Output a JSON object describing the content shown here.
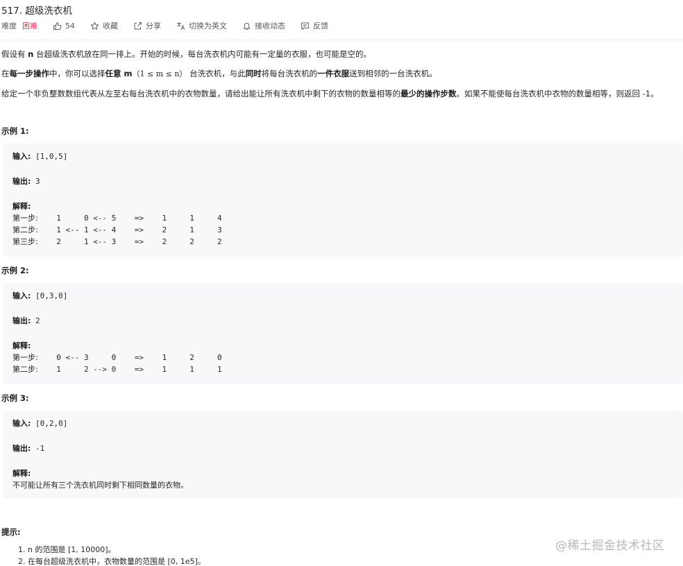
{
  "problem": {
    "title": "517. 超级洗衣机",
    "difficulty_label": "难度",
    "difficulty_value": "困难",
    "likes": "54",
    "favorite_label": "收藏",
    "share_label": "分享",
    "switch_lang_label": "切换为英文",
    "notify_label": "接收动态",
    "feedback_label": "反馈"
  },
  "colors": {
    "difficulty_hard": "#ff2d55",
    "code_bg": "#f7f8fa"
  },
  "description": {
    "p1_a": "假设有 ",
    "p1_b": "n",
    "p1_c": " 台超级洗衣机放在同一排上。开始的时候，每台洗衣机内可能有一定量的衣服，也可能是空的。",
    "p2_a": "在",
    "p2_b": "每一步操作",
    "p2_c": "中，你可以选择",
    "p2_d": "任意 m",
    "p2_e": "（1 ≤ m ≤ n）",
    "p2_f": " 台洗衣机，与此",
    "p2_g": "同时",
    "p2_h": "将每台洗衣机的",
    "p2_i": "一件衣服",
    "p2_j": "送到相邻的一台洗衣机。",
    "p3_a": "给定一个非负整数数组代表从左至右每台洗衣机中的衣物数量，请给出能让所有洗衣机中剩下的衣物的数量相等的",
    "p3_b": "最少的操作步数",
    "p3_c": "。如果不能使每台洗衣机中衣物的数量相等，则返回 -1。"
  },
  "examples": [
    {
      "title": "示例 1:",
      "input_label": "输入:",
      "input": "[1,0,5]",
      "output_label": "输出:",
      "output": "3",
      "explain_label": "解释:",
      "steps": [
        {
          "label": "第一步:",
          "text": "    1     0 <-- 5    =>    1     1     4"
        },
        {
          "label": "第二步:",
          "text": "    1 <-- 1 <-- 4    =>    2     1     3"
        },
        {
          "label": "第三步:",
          "text": "    2     1 <-- 3    =>    2     2     2"
        }
      ]
    },
    {
      "title": "示例 2:",
      "input_label": "输入:",
      "input": "[0,3,0]",
      "output_label": "输出:",
      "output": "2",
      "explain_label": "解释:",
      "steps": [
        {
          "label": "第一步:",
          "text": "    0 <-- 3     0    =>    1     2     0"
        },
        {
          "label": "第二步:",
          "text": "    1     2 --> 0    =>    1     1     1"
        }
      ]
    },
    {
      "title": "示例 3:",
      "input_label": "输入:",
      "input": "[0,2,0]",
      "output_label": "输出:",
      "output": "-1",
      "explain_label": "解释:",
      "explain_text": "不可能让所有三个洗衣机同时剩下相同数量的衣物。"
    }
  ],
  "hints": {
    "title": "提示:",
    "items": [
      "1. n 的范围是 [1, 10000]。",
      "2. 在每台超级洗衣机中，衣物数量的范围是 [0, 1e5]。"
    ]
  },
  "watermark": "@稀土掘金技术社区"
}
